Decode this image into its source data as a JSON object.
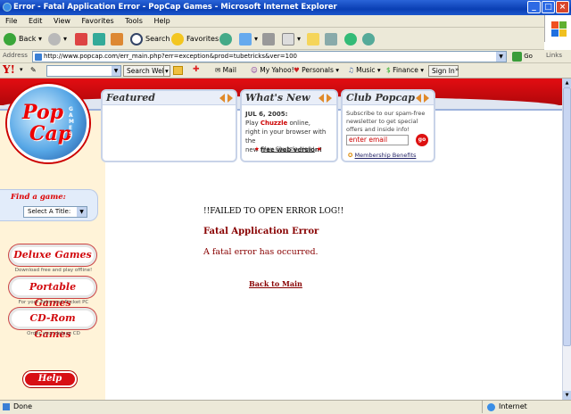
{
  "window": {
    "title": "Error - Fatal Application Error - PopCap Games - Microsoft Internet Explorer"
  },
  "menu": [
    "File",
    "Edit",
    "View",
    "Favorites",
    "Tools",
    "Help"
  ],
  "toolbar": {
    "back": "Back",
    "search": "Search",
    "favorites": "Favorites"
  },
  "address": {
    "label": "Address",
    "url": "http://www.popcap.com/err_main.php?err=exception&prod=tubetricks&ver=100",
    "go": "Go",
    "links": "Links"
  },
  "yahoo": {
    "search_web": "Search Web",
    "mail": "Mail",
    "my_yahoo": "My Yahoo!",
    "personals": "Personals",
    "music": "Music",
    "finance": "Finance",
    "sign_in": "Sign In"
  },
  "logo": {
    "line1": "Pop",
    "line2": "Cap",
    "side": "GAMES"
  },
  "featured": {
    "title": "Featured"
  },
  "whats_new": {
    "title": "What's New",
    "date": "JUL 6, 2005:",
    "text_1": "Play ",
    "game": "Chuzzle",
    "text_2": " online,",
    "text_3": "right in your browser with the",
    "text_4": "new ",
    "text_5": "free web version!",
    "link": "Play Chuzzle Now!"
  },
  "club": {
    "title": "Club Popcap",
    "blurb": "Subscribe to our spam-free newsletter to get special offers and inside info!",
    "email_placeholder": "enter email",
    "go": "go",
    "benefits": "Membership Benefits"
  },
  "sidebar": {
    "find_label": "Find a game:",
    "select_value": "Select A Title:",
    "deluxe": "Deluxe Games",
    "deluxe_sub": "Download free and play offline!",
    "portable": "Portable Games",
    "portable_sub": "For your Palm and Pocket PC",
    "cdrom": "CD-Rom Games",
    "cdrom_sub": "Order your deluxe CD",
    "help": "Help"
  },
  "error": {
    "log_msg": "!!FAILED TO OPEN ERROR LOG!!",
    "heading": "Fatal Application Error",
    "message": "A fatal error has occurred.",
    "back_link": "Back to Main"
  },
  "status": {
    "left": "Done",
    "zone": "Internet"
  }
}
